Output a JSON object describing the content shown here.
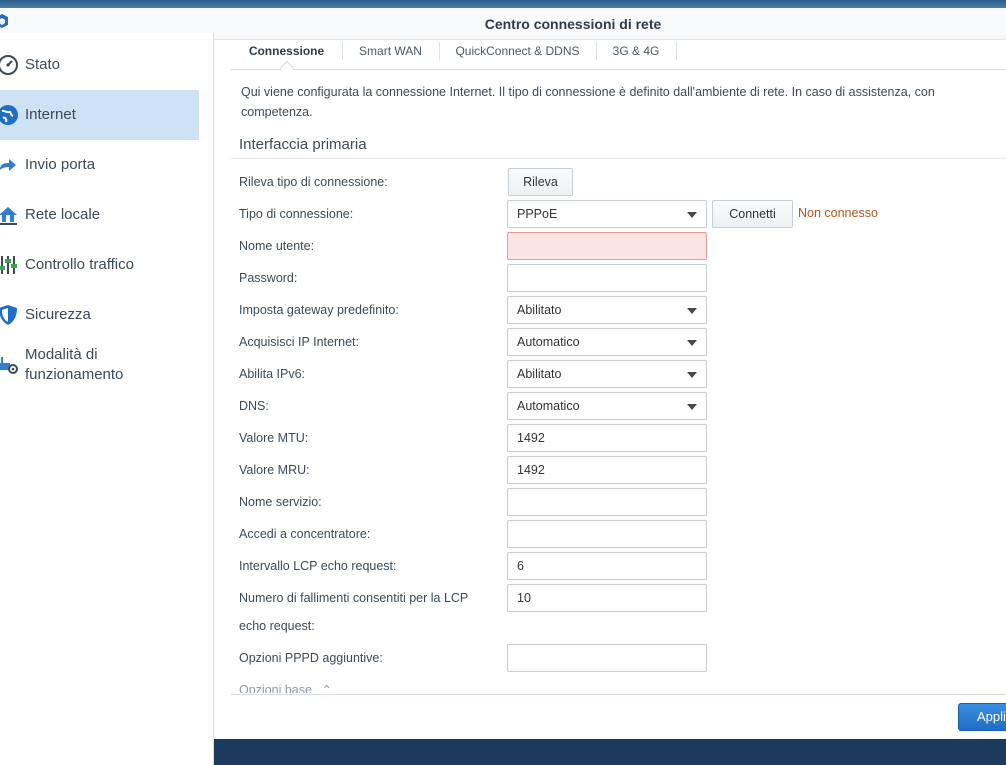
{
  "window": {
    "title": "Centro connessioni di rete"
  },
  "sidebar": {
    "items": [
      {
        "label": "Stato",
        "icon": "gauge-icon"
      },
      {
        "label": "Internet",
        "icon": "globe-icon",
        "active": true
      },
      {
        "label": "Invio porta",
        "icon": "arrow-right-icon"
      },
      {
        "label": "Rete locale",
        "icon": "home-network-icon"
      },
      {
        "label": "Controllo traffico",
        "icon": "sliders-icon"
      },
      {
        "label": "Sicurezza",
        "icon": "shield-icon"
      },
      {
        "label": "Modalità di",
        "label2": "funzionamento",
        "icon": "router-gear-icon"
      }
    ]
  },
  "tabs": [
    {
      "label": "Connessione",
      "active": true
    },
    {
      "label": "Smart WAN"
    },
    {
      "label": "QuickConnect & DDNS"
    },
    {
      "label": "3G & 4G"
    }
  ],
  "main": {
    "description": "Qui viene configurata la connessione Internet. Il tipo di connessione è definito dall'ambiente di rete. In caso di assistenza, con competenza.",
    "section_title": "Interfaccia primaria",
    "detect_label": "Rileva tipo di connessione:",
    "detect_button": "Rileva",
    "conn_type_label": "Tipo di connessione:",
    "conn_type_value": "PPPoE",
    "connect_button": "Connetti",
    "connection_status": "Non connesso",
    "username_label": "Nome utente:",
    "username_value": "",
    "password_label": "Password:",
    "password_value": "",
    "gateway_label": "Imposta gateway predefinito:",
    "gateway_value": "Abilitato",
    "ip_label": "Acquisisci IP Internet:",
    "ip_value": "Automatico",
    "ipv6_label": "Abilita IPv6:",
    "ipv6_value": "Abilitato",
    "dns_label": "DNS:",
    "dns_value": "Automatico",
    "mtu_label": "Valore MTU:",
    "mtu_value": "1492",
    "mru_label": "Valore MRU:",
    "mru_value": "1492",
    "service_label": "Nome servizio:",
    "service_value": "",
    "concentrator_label": "Accedi a concentratore:",
    "concentrator_value": "",
    "lcp_interval_label": "Intervallo LCP echo request:",
    "lcp_interval_value": "6",
    "lcp_fail_label_line1": "Numero di fallimenti consentiti per la LCP",
    "lcp_fail_label_line2": "echo request:",
    "lcp_fail_value": "10",
    "pppd_label": "Opzioni PPPD aggiuntive:",
    "pppd_value": "",
    "basic_options_link": "Opzioni base"
  },
  "footer": {
    "apply_button": "Appli"
  },
  "colors": {
    "accent": "#1f6dc4",
    "active_nav": "#cfe2f3",
    "error_bg": "#fae4e4",
    "status": "#b5541c"
  }
}
